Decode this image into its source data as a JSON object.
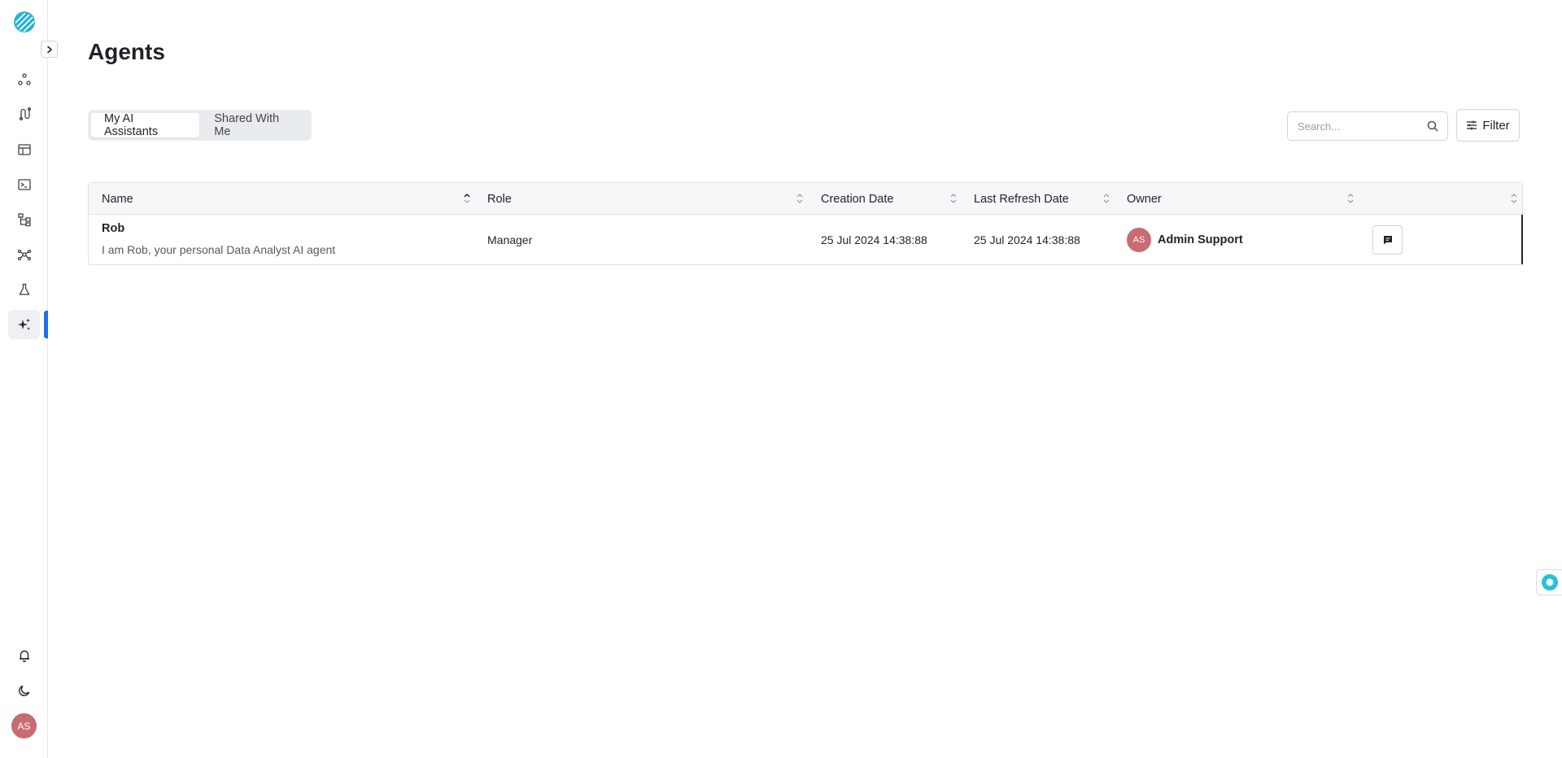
{
  "app": {
    "title": "Agents"
  },
  "sidebar": {
    "collapse_icon": "chevron-right-icon",
    "items": [
      {
        "icon": "nodes-icon",
        "active": false
      },
      {
        "icon": "flow-icon",
        "active": false
      },
      {
        "icon": "table-icon",
        "active": false
      },
      {
        "icon": "terminal-icon",
        "active": false
      },
      {
        "icon": "hierarchy-icon",
        "active": false
      },
      {
        "icon": "network-icon",
        "active": false
      },
      {
        "icon": "flask-icon",
        "active": false
      },
      {
        "icon": "sparkle-icon",
        "active": true
      }
    ],
    "bottom": {
      "bell_icon": "bell-icon",
      "moon_icon": "moon-icon",
      "avatar_initials": "AS"
    }
  },
  "tabs": [
    {
      "label": "My AI Assistants",
      "active": true
    },
    {
      "label": "Shared With Me",
      "active": false
    }
  ],
  "search": {
    "placeholder": "Search...",
    "value": ""
  },
  "filter": {
    "label": "Filter"
  },
  "table": {
    "columns": [
      "Name",
      "Role",
      "Creation Date",
      "Last Refresh Date",
      "Owner",
      ""
    ],
    "rows": [
      {
        "name": "Rob",
        "description": "I am Rob, your personal Data Analyst AI agent",
        "role": "Manager",
        "creation_date": "25 Jul 2024 14:38:88",
        "last_refresh_date": "25 Jul 2024 14:38:88",
        "owner_initials": "AS",
        "owner_name": "Admin Support"
      }
    ]
  },
  "colors": {
    "accent": "#1f6feb",
    "avatar": "#c86b72",
    "logo": "#2bb3d1"
  }
}
